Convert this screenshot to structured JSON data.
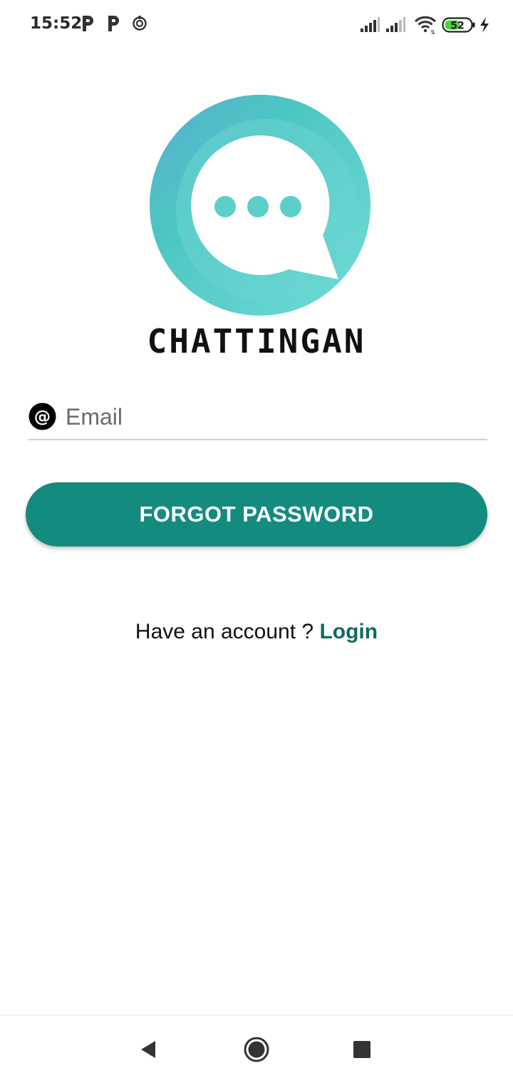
{
  "status_bar": {
    "time": "15:52",
    "notification_icons": [
      "p-app-icon",
      "p-app-icon",
      "sync-circle-icon"
    ],
    "system_icons": [
      "signal-icon",
      "signal-icon",
      "wifi-icon",
      "battery-icon",
      "charging-icon"
    ],
    "battery_level": "52",
    "battery_color": "#4cd137"
  },
  "logo": {
    "brand_name": "CHATTINGAN",
    "primary_color": "#5ccfc8",
    "dots_color": "#5ccfc8"
  },
  "form": {
    "email_icon": "at-icon",
    "email_placeholder": "Email",
    "email_value": "",
    "submit_label": "FORGOT PASSWORD",
    "button_color": "#138c7f"
  },
  "footer": {
    "prompt_text": "Have an account ? ",
    "login_label": "Login",
    "link_color": "#0e6b60"
  },
  "nav_bar": {
    "buttons": [
      "back-icon",
      "home-icon",
      "recents-icon"
    ]
  }
}
